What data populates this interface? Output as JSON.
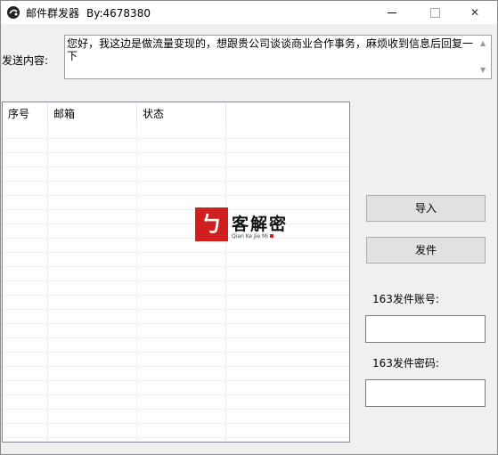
{
  "window": {
    "title": "邮件群发器",
    "author": "By:4678380",
    "min_label": "—",
    "close_label": "✕",
    "icon": "app-icon"
  },
  "compose": {
    "label": "发送内容:",
    "message": "您好，我这边是做流量变现的，想跟贵公司谈谈商业合作事务，麻烦收到信息后回复一下"
  },
  "table": {
    "columns": [
      "序号",
      "邮箱",
      "状态"
    ],
    "rows": []
  },
  "watermark": {
    "logo_char": "ㄅ",
    "text": "客解密",
    "sub": "Qian Ke Jie Mi"
  },
  "buttons": {
    "import_label": "导入",
    "send_label": "发件"
  },
  "account": {
    "account_label": "163发件账号:",
    "password_label": "163发件密码:",
    "account_value": "",
    "password_value": ""
  }
}
